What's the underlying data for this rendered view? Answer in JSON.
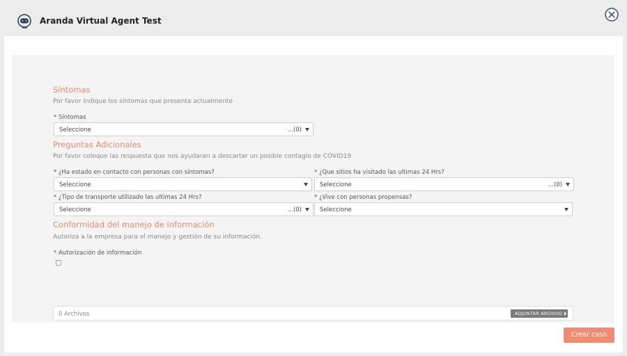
{
  "header": {
    "title": "Aranda Virtual Agent Test"
  },
  "form": {
    "sintomas": {
      "title": "Síntomas",
      "description": "Por favor indique los síntomas que presenta actualmente",
      "field_label": "* Síntomas",
      "value": "Seleccione",
      "count": "...(0)"
    },
    "preguntas": {
      "title": "Preguntas Adicionales",
      "description": "Por favor coloque las respuesta que nos ayudaran a descartar un posible contagio de COVID19",
      "contacto": {
        "label": "* ¿Ha estado en contacto con personas con síntomas?",
        "value": "Seleccione"
      },
      "sitios": {
        "label": "* ¿Que sitios ha visitado las ultimas 24 Hrs?",
        "value": "Seleccione",
        "count": "...(0)"
      },
      "transporte": {
        "label": "* ¿Tipo de transporte utilizado las ultimas 24 Hrs?",
        "value": "Seleccione",
        "count": "...(0)"
      },
      "propensas": {
        "label": "* ¿Vive con personas propensas?",
        "value": "Seleccione"
      }
    },
    "conformidad": {
      "title": "Conformidad del manejo de información",
      "description": "Autoriza a la empresa para el manejo y gestión de su información.",
      "field_label": "* Autorización de información"
    },
    "attachments": {
      "count_label": "0 Archivos",
      "button_label": "ADJUNTAR ARCHIVO"
    },
    "submit_label": "Crear caso"
  },
  "colors": {
    "accent": "#f08c73",
    "section_title": "#e88a6d",
    "panel": "#f4f4f4",
    "close_icon": "#3a4a6b"
  }
}
